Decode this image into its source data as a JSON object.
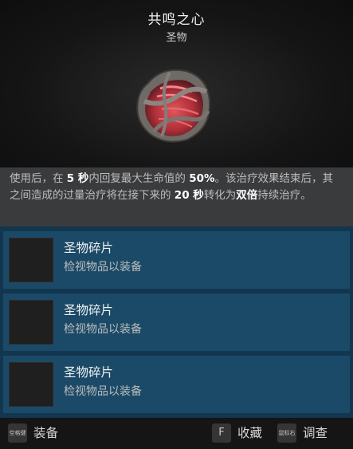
{
  "item": {
    "title": "共鸣之心",
    "category": "圣物"
  },
  "description": {
    "p1": "使用后，在 ",
    "v1": "5 秒",
    "p2": "内回复最大生命值的 ",
    "v2": "50%",
    "p3": "。该治疗效果结束后，其之间造成的过量治疗将在接下来的 ",
    "v3": "20 秒",
    "p4": "转化为",
    "v4": "双倍",
    "p5": "持续治疗。"
  },
  "slots": [
    {
      "name": "圣物碎片",
      "hint": "检视物品以装备"
    },
    {
      "name": "圣物碎片",
      "hint": "检视物品以装备"
    },
    {
      "name": "圣物碎片",
      "hint": "检视物品以装备"
    }
  ],
  "footer": {
    "equip_key": "空格键",
    "equip_label": "装备",
    "favorite_key": "F",
    "favorite_label": "收藏",
    "inspect_key": "鼠标右",
    "inspect_label": "调查"
  },
  "colors": {
    "panel_bg": "#141414",
    "desc_bg": "#3a3b3d",
    "slots_bg": "#12364f",
    "slot_bg": "#1b4a68",
    "relic_red": "#c0393f"
  }
}
